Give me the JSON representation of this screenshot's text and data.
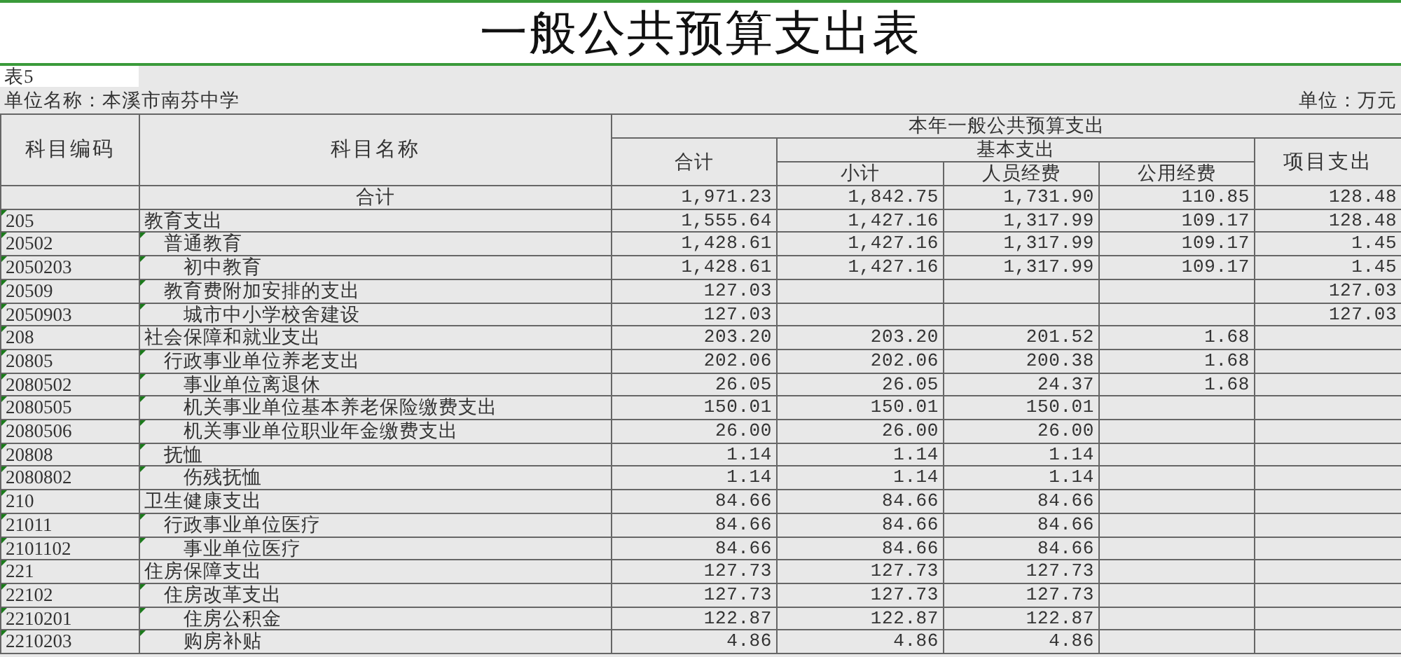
{
  "title": "一般公共预算支出表",
  "table_no": "表5",
  "unit_name": "单位名称：本溪市南芬中学",
  "unit": "单位：万元",
  "header": {
    "code": "科目编码",
    "name": "科目名称",
    "group": "本年一般公共预算支出",
    "total": "合计",
    "basic": "基本支出",
    "subtotal": "小计",
    "personnel": "人员经费",
    "public": "公用经费",
    "project": "项目支出"
  },
  "total_row": {
    "label": "合计",
    "values": {
      "total": "1,971.23",
      "subtotal": "1,842.75",
      "personnel": "1,731.90",
      "public": "110.85",
      "project": "128.48"
    }
  },
  "rows": [
    {
      "code": "205",
      "name": "教育支出",
      "values": {
        "total": "1,555.64",
        "subtotal": "1,427.16",
        "personnel": "1,317.99",
        "public": "109.17",
        "project": "128.48"
      },
      "children": [
        {
          "code": "20502",
          "name": "普通教育",
          "values": {
            "total": "1,428.61",
            "subtotal": "1,427.16",
            "personnel": "1,317.99",
            "public": "109.17",
            "project": "1.45"
          },
          "children": [
            {
              "code": "2050203",
              "name": "初中教育",
              "values": {
                "total": "1,428.61",
                "subtotal": "1,427.16",
                "personnel": "1,317.99",
                "public": "109.17",
                "project": "1.45"
              }
            }
          ]
        },
        {
          "code": "20509",
          "name": "教育费附加安排的支出",
          "values": {
            "total": "127.03",
            "project": "127.03"
          },
          "children": [
            {
              "code": "2050903",
              "name": "城市中小学校舍建设",
              "values": {
                "total": "127.03",
                "project": "127.03"
              }
            }
          ]
        }
      ]
    },
    {
      "code": "208",
      "name": "社会保障和就业支出",
      "values": {
        "total": "203.20",
        "subtotal": "203.20",
        "personnel": "201.52",
        "public": "1.68"
      },
      "children": [
        {
          "code": "20805",
          "name": "行政事业单位养老支出",
          "values": {
            "total": "202.06",
            "subtotal": "202.06",
            "personnel": "200.38",
            "public": "1.68"
          },
          "children": [
            {
              "code": "2080502",
              "name": "事业单位离退休",
              "values": {
                "total": "26.05",
                "subtotal": "26.05",
                "personnel": "24.37",
                "public": "1.68"
              }
            },
            {
              "code": "2080505",
              "name": "机关事业单位基本养老保险缴费支出",
              "values": {
                "total": "150.01",
                "subtotal": "150.01",
                "personnel": "150.01"
              }
            },
            {
              "code": "2080506",
              "name": "机关事业单位职业年金缴费支出",
              "values": {
                "total": "26.00",
                "subtotal": "26.00",
                "personnel": "26.00"
              }
            }
          ]
        },
        {
          "code": "20808",
          "name": "抚恤",
          "values": {
            "total": "1.14",
            "subtotal": "1.14",
            "personnel": "1.14"
          },
          "children": [
            {
              "code": "2080802",
              "name": "伤残抚恤",
              "values": {
                "total": "1.14",
                "subtotal": "1.14",
                "personnel": "1.14"
              }
            }
          ]
        }
      ]
    },
    {
      "code": "210",
      "name": "卫生健康支出",
      "values": {
        "total": "84.66",
        "subtotal": "84.66",
        "personnel": "84.66"
      },
      "children": [
        {
          "code": "21011",
          "name": "行政事业单位医疗",
          "values": {
            "total": "84.66",
            "subtotal": "84.66",
            "personnel": "84.66"
          },
          "children": [
            {
              "code": "2101102",
              "name": "事业单位医疗",
              "values": {
                "total": "84.66",
                "subtotal": "84.66",
                "personnel": "84.66"
              }
            }
          ]
        }
      ]
    },
    {
      "code": "221",
      "name": "住房保障支出",
      "values": {
        "total": "127.73",
        "subtotal": "127.73",
        "personnel": "127.73"
      },
      "children": [
        {
          "code": "22102",
          "name": "住房改革支出",
          "values": {
            "total": "127.73",
            "subtotal": "127.73",
            "personnel": "127.73"
          },
          "children": [
            {
              "code": "2210201",
              "name": "住房公积金",
              "values": {
                "total": "122.87",
                "subtotal": "122.87",
                "personnel": "122.87"
              }
            },
            {
              "code": "2210203",
              "name": "购房补贴",
              "values": {
                "total": "4.86",
                "subtotal": "4.86",
                "personnel": "4.86"
              }
            }
          ]
        }
      ]
    }
  ]
}
